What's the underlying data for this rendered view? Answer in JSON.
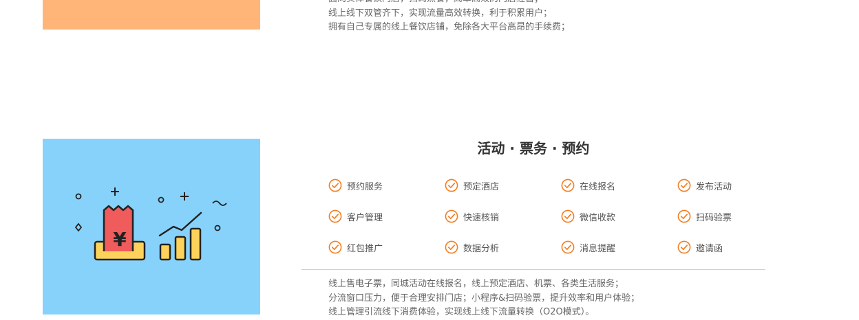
{
  "top_section": {
    "description_lines": [
      "面向实体餐饮门店，扫码点餐，简单高效的门店经营；",
      "线上线下双管齐下，实现流量高效转换，利于积累用户；",
      "拥有自己专属的线上餐饮店铺，免除各大平台高昂的手续费；"
    ]
  },
  "section": {
    "title": "活动 · 票务 · 预约",
    "features": [
      "预约服务",
      "预定酒店",
      "在线报名",
      "发布活动",
      "客户管理",
      "快速核销",
      "微信收款",
      "扫码验票",
      "红包推广",
      "数据分析",
      "消息提醒",
      "邀请函"
    ],
    "description_lines": [
      "线上售电子票，同城活动在线报名，线上预定酒店、机票、各类生活服务；",
      "分流窗口压力，便于合理安排门店；小程序&扫码验票，提升效率和用户体验；",
      "线上管理引流线下消费体验，实现线上线下流量转换（O2O模式）。"
    ],
    "illustration_label": "¥"
  },
  "colors": {
    "accent": "#f47d1f",
    "top_image_bg": "#ffb577",
    "feature_image_bg": "#87d2fb",
    "receipt_red": "#f05b5b",
    "bar_yellow": "#fcd25b"
  }
}
